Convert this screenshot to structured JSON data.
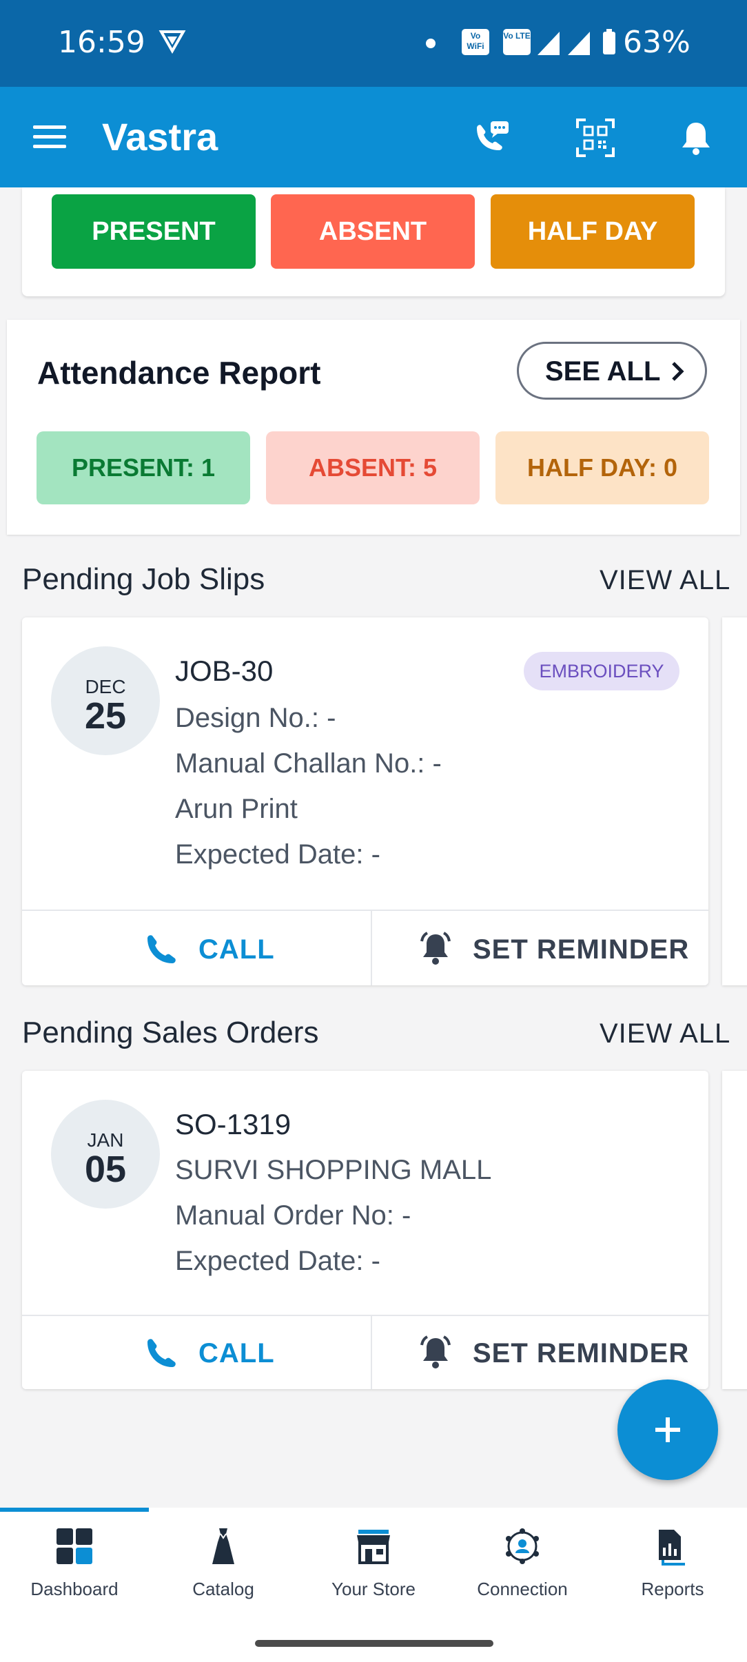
{
  "status_bar": {
    "time": "16:59",
    "battery": "63%",
    "chip_wifi": "Vo WiFi",
    "chip_lte": "Vo LTE"
  },
  "app_bar": {
    "title": "Vastra"
  },
  "mark_attendance": {
    "present": "PRESENT",
    "absent": "ABSENT",
    "half_day": "HALF DAY"
  },
  "attendance_report": {
    "title": "Attendance Report",
    "see_all": "SEE ALL",
    "present": "PRESENT: 1",
    "absent": "ABSENT: 5",
    "half_day": "HALF DAY: 0"
  },
  "job_slips": {
    "title": "Pending Job Slips",
    "view_all": "VIEW ALL",
    "card": {
      "month": "DEC",
      "day": "25",
      "id": "JOB-30",
      "tag": "EMBROIDERY",
      "design": "Design No.: -",
      "challan": "Manual Challan No.: -",
      "party": "Arun Print",
      "expected": "Expected Date: -",
      "call": "CALL",
      "reminder": "SET REMINDER"
    }
  },
  "sales_orders": {
    "title": "Pending Sales Orders",
    "view_all": "VIEW ALL",
    "card": {
      "month": "JAN",
      "day": "05",
      "id": "SO-1319",
      "party": "SURVI SHOPPING MALL",
      "manual_order": "Manual Order No: -",
      "expected": "Expected Date: -",
      "call": "CALL",
      "reminder": "SET REMINDER"
    }
  },
  "fab": {
    "icon": "plus-icon"
  },
  "bottom_nav": [
    {
      "label": "Dashboard",
      "icon": "dashboard-icon"
    },
    {
      "label": "Catalog",
      "icon": "dress-icon"
    },
    {
      "label": "Your Store",
      "icon": "store-icon"
    },
    {
      "label": "Connection",
      "icon": "network-icon"
    },
    {
      "label": "Reports",
      "icon": "report-icon"
    }
  ],
  "colors": {
    "primary": "#0c8ed4",
    "status_bar": "#0b67a8",
    "present": "#0aa344",
    "absent": "#ff6650",
    "half_day": "#e58e0a",
    "present_bg": "#a3e4c0",
    "absent_bg": "#fdd3cd",
    "half_day_bg": "#fde3c6",
    "tag_bg": "#e5e0f7",
    "tag_text": "#6b4fbf"
  }
}
